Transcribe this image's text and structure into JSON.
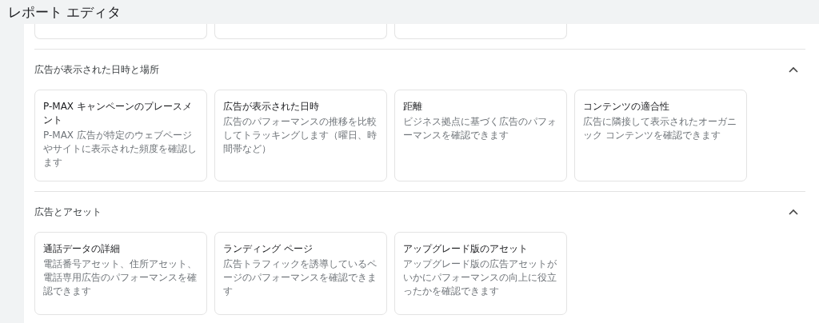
{
  "window": {
    "title": "レポート エディタ"
  },
  "sections": [
    {
      "title": "広告が表示された日時と場所",
      "expanded": true,
      "cards": [
        {
          "title": "P-MAX キャンペーンのプレースメント",
          "description": "P-MAX 広告が特定のウェブページやサイトに表示された頻度を確認します"
        },
        {
          "title": "広告が表示された日時",
          "description": "広告のパフォーマンスの推移を比較してトラッキングします（曜日、時間帯など）"
        },
        {
          "title": "距離",
          "description": "ビジネス拠点に基づく広告のパフォーマンスを確認できます"
        },
        {
          "title": "コンテンツの適合性",
          "description": "広告に隣接して表示されたオーガニック コンテンツを確認できます"
        }
      ]
    },
    {
      "title": "広告とアセット",
      "expanded": true,
      "cards": [
        {
          "title": "通話データの詳細",
          "description": "電話番号アセット、住所アセット、電話専用広告のパフォーマンスを確認できます"
        },
        {
          "title": "ランディング ページ",
          "description": "広告トラフィックを誘導しているページのパフォーマンスを確認できます"
        },
        {
          "title": "アップグレード版のアセット",
          "description": "アップグレード版の広告アセットがいかにパフォーマンスの向上に役立ったかを確認できます"
        }
      ]
    }
  ]
}
